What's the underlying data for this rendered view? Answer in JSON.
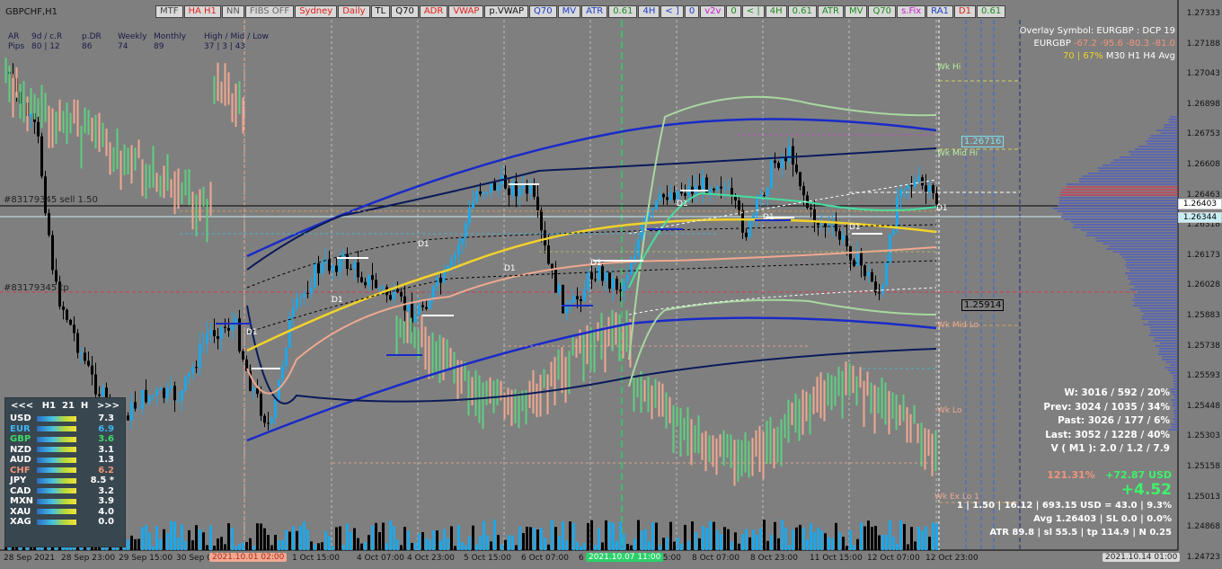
{
  "window": {
    "title": "GBPCHF,H1"
  },
  "toolbar": [
    {
      "label": "MTF",
      "color": "#444"
    },
    {
      "label": "HA H1",
      "color": "#e0201a"
    },
    {
      "label": "NN",
      "color": "#555"
    },
    {
      "label": "FIBS OFF",
      "color": "#666"
    },
    {
      "label": "Sydney",
      "color": "#e0201a"
    },
    {
      "label": "Daily",
      "color": "#e0201a"
    },
    {
      "label": "TL",
      "color": "#111"
    },
    {
      "label": "Q70",
      "color": "#111"
    },
    {
      "label": "ADR",
      "color": "#e0201a"
    },
    {
      "label": "VWAP",
      "color": "#e0201a"
    },
    {
      "label": "p.VWAP",
      "color": "#111"
    },
    {
      "label": "Q70",
      "color": "#1a3cc4"
    },
    {
      "label": "MV",
      "color": "#1a3cc4"
    },
    {
      "label": "ATR",
      "color": "#1a3cc4"
    },
    {
      "label": "0.61",
      "color": "#1a8a1a"
    },
    {
      "label": "4H",
      "color": "#1a3cc4"
    },
    {
      "label": "< ]",
      "color": "#1a3cc4"
    },
    {
      "label": "0",
      "color": "#1a3cc4"
    },
    {
      "label": "v2v",
      "color": "#c81ad0"
    },
    {
      "label": "0",
      "color": "#1a8a1a"
    },
    {
      "label": "< |",
      "color": "#1a8a1a"
    },
    {
      "label": "4H",
      "color": "#1a8a1a"
    },
    {
      "label": "0.61",
      "color": "#1a8a1a"
    },
    {
      "label": "ATR",
      "color": "#1a8a1a"
    },
    {
      "label": "MV",
      "color": "#1a8a1a"
    },
    {
      "label": "Q70",
      "color": "#1a8a1a"
    },
    {
      "label": "s.Fix",
      "color": "#c81ad0"
    },
    {
      "label": "RA1",
      "color": "#1a3cc4"
    },
    {
      "label": "D1",
      "color": "#e0201a"
    },
    {
      "label": "0.61",
      "color": "#1a8a1a"
    }
  ],
  "stats_header": {
    "rows": [
      [
        "AR",
        "9d / c.R",
        "p.DR",
        "Weekly",
        "Monthly",
        "High / Mid / Low"
      ],
      [
        "Pips",
        "80 | 12",
        "86",
        "74",
        "89",
        "37 | 3 | 43"
      ]
    ]
  },
  "overlay": {
    "line1": "Overlay Symbol: EURGBP : DCP 19",
    "line2_sym": "EURGBP",
    "line2_vals": "-67.2 -95.6 -80.3 -81.0",
    "line3_pct": "70 | 67%",
    "line3_tfs": "M30     H1     H4    Avg"
  },
  "chart_labels": {
    "sell": "#83179345 sell 1.50",
    "tp": "#83179345 tp",
    "wk_hi": "Wk Hi",
    "wk_mid_hi": "Wk Mid Hi",
    "wk_mid_lo": "Wk Mid Lo",
    "wk_lo": "Wk Lo",
    "wk_ex_lo": "Wk Ex Lo 1",
    "d1": "D1"
  },
  "level_boxes": [
    {
      "text": "1.26716",
      "color": "#7fe0f0"
    },
    {
      "text": "1.25914",
      "color": "#000"
    }
  ],
  "currency_panel": {
    "prev": "<<<",
    "tf": "H1",
    "n": "21",
    "mode": "H",
    "next": ">>>",
    "items": [
      {
        "name": "USD",
        "value": "7.3",
        "color": "#ffffff"
      },
      {
        "name": "EUR",
        "value": "6.9",
        "color": "#3fb6f2"
      },
      {
        "name": "GBP",
        "value": "3.6",
        "color": "#3fd96a"
      },
      {
        "name": "NZD",
        "value": "3.1",
        "color": "#ffffff"
      },
      {
        "name": "AUD",
        "value": "1.3",
        "color": "#ffffff"
      },
      {
        "name": "CHF",
        "value": "6.2",
        "color": "#f0947a"
      },
      {
        "name": "JPY",
        "value": "8.5 *",
        "color": "#ffffff"
      },
      {
        "name": "CAD",
        "value": "3.2",
        "color": "#ffffff"
      },
      {
        "name": "MXN",
        "value": "3.9",
        "color": "#ffffff"
      },
      {
        "name": "XAU",
        "value": "4.0",
        "color": "#ffffff"
      },
      {
        "name": "XAG",
        "value": "0.0",
        "color": "#ffffff"
      }
    ]
  },
  "account_stats": {
    "w": "W: 3016 / 592 / 20%",
    "prev": "Prev: 3024 / 1035 / 34%",
    "past": "Past: 3026 / 177 / 6%",
    "last": "Last: 3052 / 1228 / 40%",
    "v": "V ( M1 ): 2.0 / 1.2 / 7.9"
  },
  "pnl": {
    "pct": "121.31%",
    "usd": "+72.87 USD",
    "big": "+4.52",
    "row1": "1  |  1.50  |  16.12  |  693.15 USD = 43.0  |  9.3%",
    "row2": "Avg 1.26403  |  SL 0.0  |  0.0%",
    "row3": "ATR 89.8  |  sl 55.5  |  tp 114.9  |  N 0.25"
  },
  "price_axis": [
    "1.27333",
    "1.27188",
    "1.27043",
    "1.26898",
    "1.26753",
    "1.26608",
    "1.26463",
    "1.26318",
    "1.26173",
    "1.26028",
    "1.25883",
    "1.25738",
    "1.25593",
    "1.25448",
    "1.25303",
    "1.25158",
    "1.25013",
    "1.24868",
    "1.24723"
  ],
  "price_boxes": [
    {
      "text": "1.26403",
      "bg": "#ffffff",
      "color": "#000"
    },
    {
      "text": "1.26344",
      "bg": "#c9eef5",
      "color": "#000"
    }
  ],
  "time_axis": [
    "28 Sep 2021",
    "28 Sep 23:00",
    "29 Sep 15:00",
    "30 Sep 0",
    "1 Oct 15:00",
    "4 Oct 07:00",
    "4 Oct 23:00",
    "5 Oct 15:00",
    "6 Oct 07:00",
    "6",
    "7 Oct 15:00",
    "8 Oct 07:00",
    "8 Oct 23:00",
    "11 Oct 15:00",
    "12 Oct 07:00",
    "12 Oct 23:00"
  ],
  "time_boxes": [
    {
      "text": "2021.10.01 02:00",
      "bg": "#f0a890",
      "color": "#b02a1a"
    },
    {
      "text": "2021.10.07 11:00",
      "bg": "#2bd06a",
      "color": "#ffffff"
    },
    {
      "text": "2021.10.14 01:00",
      "bg": "#d9d9d9",
      "color": "#222"
    }
  ]
}
